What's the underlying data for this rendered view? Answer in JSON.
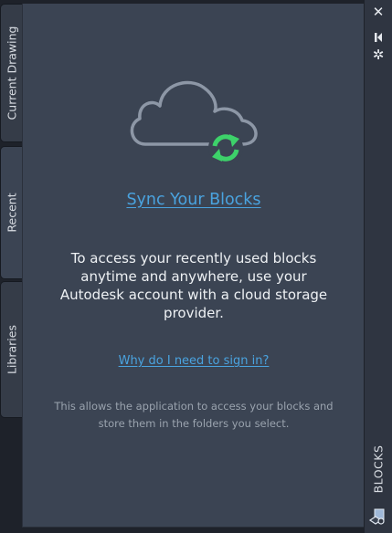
{
  "tabs": [
    {
      "label": "Current Drawing"
    },
    {
      "label": "Recent"
    },
    {
      "label": "Libraries"
    }
  ],
  "panel": {
    "sync_title": "Sync Your Blocks",
    "main_text": "To access your recently used blocks anytime and anywhere, use your Autodesk account with a cloud storage provider.",
    "why_link": "Why do I need to sign in?",
    "footer_text": "This allows the application to access your blocks and store them in the folders you select."
  },
  "palette": {
    "title": "BLOCKS",
    "close_glyph": "✕",
    "settings_glyph": "✲"
  },
  "icons": {
    "cloud": "cloud-icon",
    "sync": "sync-arrows-icon",
    "close": "close-icon",
    "autohide": "autohide-icon",
    "settings": "settings-icon",
    "blocks": "blocks-palette-icon"
  },
  "colors": {
    "panel_bg": "#3b4453",
    "link": "#4aa3df",
    "sync_green": "#3dd26a",
    "cloud_stroke": "#8d97a6"
  }
}
